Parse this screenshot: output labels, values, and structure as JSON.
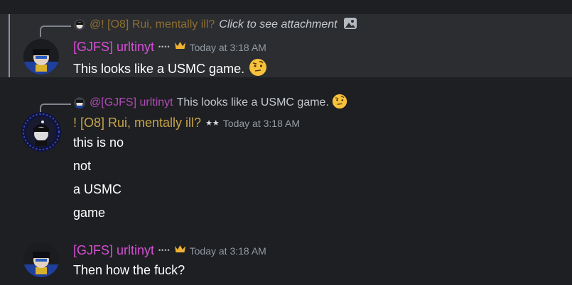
{
  "messages": [
    {
      "reply": {
        "author": "@! [O8] Rui, mentally ill?",
        "attachment_text": "Click to see attachment",
        "icon": "image-icon"
      },
      "author": "[GJFS] urltinyt",
      "badge": "••••",
      "crown_icon": "crown-icon",
      "timestamp": "Today at 3:18 AM",
      "lines": [
        "This looks like a USMC game."
      ],
      "emoji": "face-with-raised-eyebrow-emoji"
    },
    {
      "reply": {
        "author": "@[GJFS] urltinyt",
        "text": "This looks like a USMC game.",
        "emoji": "face-with-raised-eyebrow-emoji"
      },
      "author": "! [O8] Rui, mentally ill?",
      "badge": "★★",
      "timestamp": "Today at 3:18 AM",
      "lines": [
        "this is no",
        "not",
        "a USMC",
        "game"
      ]
    },
    {
      "author": "[GJFS] urltinyt",
      "badge": "••••",
      "crown_icon": "crown-icon",
      "timestamp": "Today at 3:18 AM",
      "lines": [
        "Then how the fuck?"
      ]
    }
  ],
  "colors": {
    "background": "#1e1f22",
    "highlight": "#2b2d31",
    "pink_name": "#d64ed6",
    "gold_name": "#c6a54a"
  }
}
